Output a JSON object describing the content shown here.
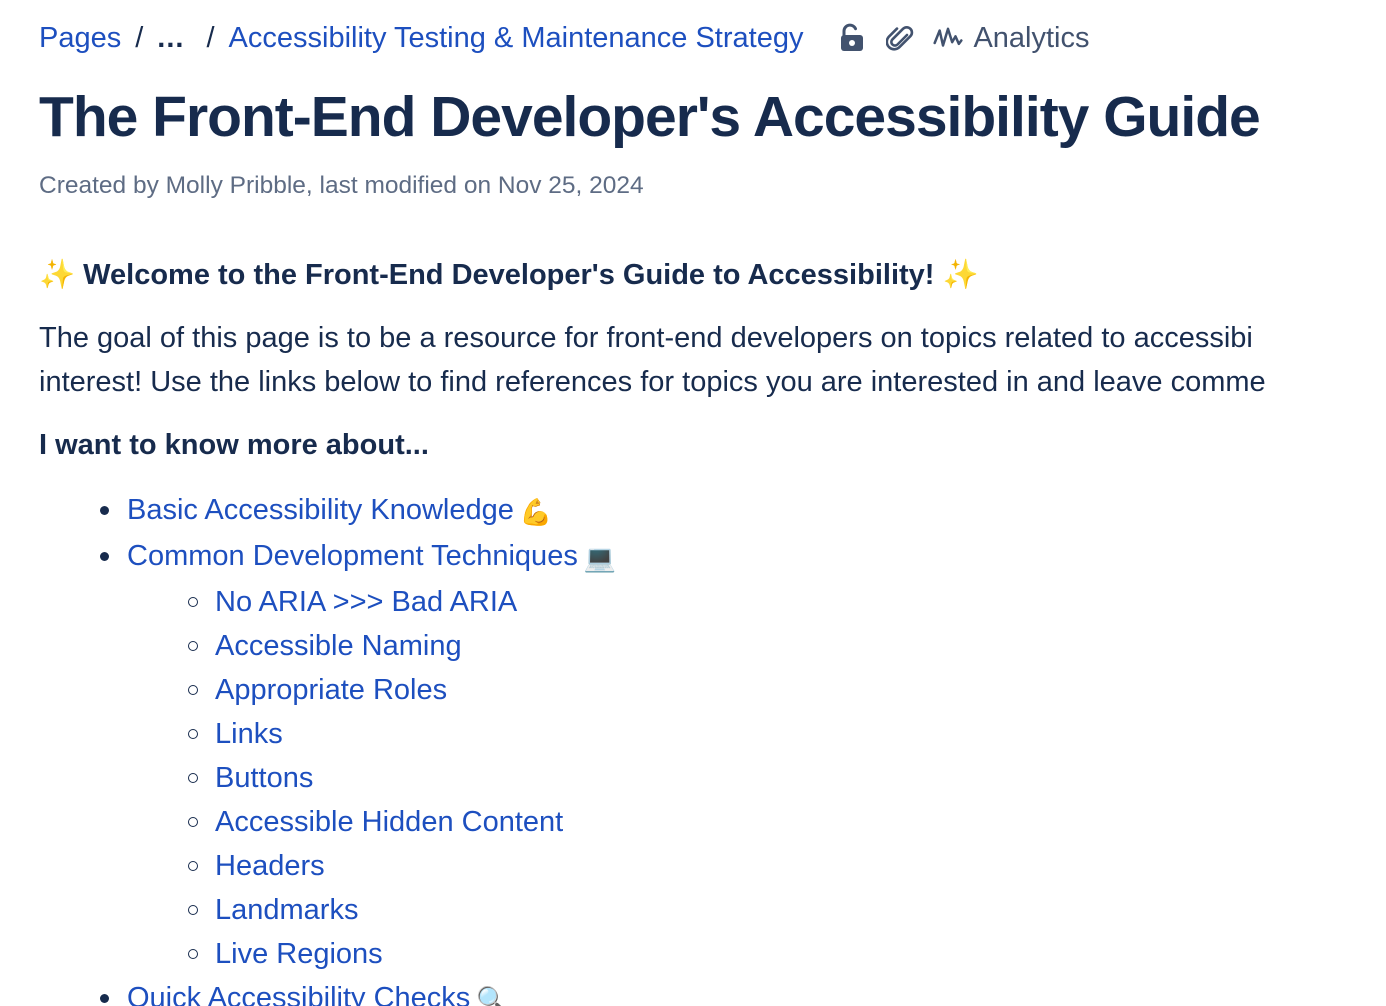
{
  "breadcrumb": {
    "root": "Pages",
    "separator": "/",
    "ellipsis": "...",
    "parent": "Accessibility Testing & Maintenance Strategy"
  },
  "toolbar": {
    "restrictions_icon": "unlocked-padlock-icon",
    "attachments_icon": "paperclip-icon",
    "analytics_icon": "analytics-line-icon",
    "analytics_label": "Analytics"
  },
  "page": {
    "title": "The Front-End Developer's Accessibility Guide",
    "byline": "Created by Molly Pribble, last modified on Nov 25, 2024"
  },
  "content": {
    "welcome_sparkle": "✨",
    "welcome": "Welcome to the Front-End Developer's Guide to Accessibility!",
    "intro_line1": "The goal of this page is to be a resource for front-end developers on topics related to accessibi",
    "intro_line2": "interest! Use the links below to find references for topics you are interested in and leave comme",
    "know_more": "I want to know more about...",
    "topics": [
      {
        "label": "Basic Accessibility Knowledge",
        "emoji": "💪"
      },
      {
        "label": "Common Development Techniques",
        "emoji": "💻"
      },
      {
        "label": "Quick Accessibility Checks",
        "emoji": "🔍"
      }
    ],
    "techniques": [
      "No ARIA >>> Bad ARIA",
      "Accessible Naming",
      "Appropriate Roles",
      "Links",
      "Buttons",
      "Accessible Hidden Content",
      "Headers",
      "Landmarks",
      "Live Regions"
    ]
  },
  "colors": {
    "link": "#1d4fbf",
    "text": "#172b4d",
    "muted": "#5e6c84",
    "sparkle": "#e9b93b"
  }
}
